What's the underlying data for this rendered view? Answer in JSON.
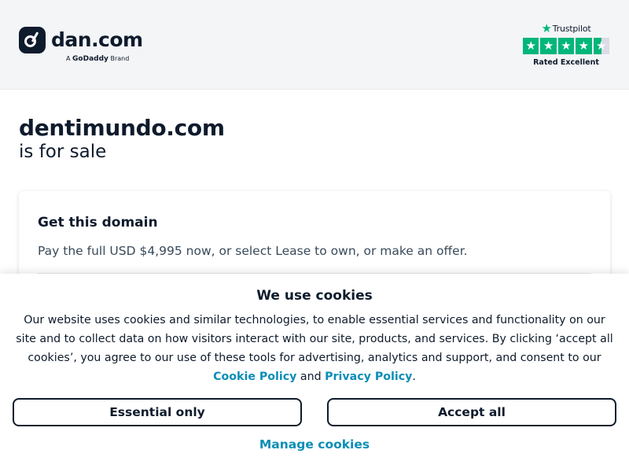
{
  "header": {
    "logo_text": "dan.com",
    "brand_prefix": "A",
    "brand_name": "GoDaddy",
    "brand_suffix": "Brand",
    "trustpilot": {
      "name": "Trustpilot",
      "rating_text": "Rated Excellent",
      "stars": 4.5,
      "star_color": "#00b67a"
    }
  },
  "main": {
    "domain": "dentimundo.com",
    "subtitle": "is for sale",
    "card": {
      "title": "Get this domain",
      "description": "Pay the full USD $4,995 now, or select Lease to own, or make an offer."
    }
  },
  "cookie": {
    "title": "We use cookies",
    "body": "Our website uses cookies and similar technologies, to enable essential services and functionality on our site and to collect data on how visitors interact with our site, products, and services. By clicking ‘accept all cookies’, you agree to our use of these tools for advertising, analytics and support, and consent to our",
    "cookie_policy_link": "Cookie Policy",
    "and_text": "and",
    "privacy_policy_link": "Privacy Policy",
    "period": ".",
    "essential_button": "Essential only",
    "accept_button": "Accept all",
    "manage_link": "Manage cookies",
    "link_color": "#0b8eb6"
  }
}
